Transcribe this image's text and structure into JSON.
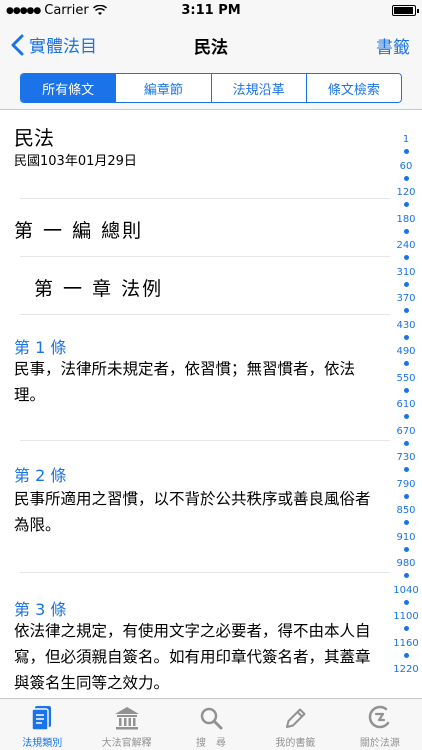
{
  "status_bar": {
    "carrier": "Carrier",
    "time": "3:11 PM"
  },
  "nav": {
    "back_label": "實體法目",
    "title": "民法",
    "right_label": "書籤"
  },
  "segments": [
    {
      "label": "所有條文",
      "active": true
    },
    {
      "label": "編章節",
      "active": false
    },
    {
      "label": "法規沿革",
      "active": false
    },
    {
      "label": "條文檢索",
      "active": false
    }
  ],
  "law": {
    "title": "民法",
    "date": "民國103年01月29日"
  },
  "part_heading": "第 一 編 總則",
  "chapter_heading": "第 一 章 法例",
  "articles": [
    {
      "label": "第 1 條",
      "text": "民事，法律所未規定者，依習慣；無習慣者，依法理。"
    },
    {
      "label": "第 2 條",
      "text": "民事所適用之習慣，以不背於公共秩序或善良風俗者為限。"
    },
    {
      "label": "第 3 條",
      "text": "依法律之規定，有使用文字之必要者，得不由本人自寫，但必須親自簽名。如有用印章代簽名者，其蓋章與簽名生同等之效力。"
    }
  ],
  "index": [
    "1",
    "60",
    "120",
    "180",
    "240",
    "310",
    "370",
    "430",
    "490",
    "550",
    "610",
    "670",
    "730",
    "790",
    "850",
    "910",
    "980",
    "1040",
    "1100",
    "1160",
    "1220"
  ],
  "tabs": [
    {
      "label": "法規類別",
      "icon": "document-icon",
      "active": true
    },
    {
      "label": "大法官解釋",
      "icon": "courthouse-icon",
      "active": false
    },
    {
      "label": "搜　尋",
      "icon": "search-icon",
      "active": false
    },
    {
      "label": "我的書籤",
      "icon": "pencil-icon",
      "active": false
    },
    {
      "label": "關於法源",
      "icon": "brand-logo-icon",
      "active": false
    }
  ],
  "colors": {
    "accent": "#1a73e8",
    "inactive_tab": "#929292",
    "bar_bg": "#f7f7f7"
  }
}
